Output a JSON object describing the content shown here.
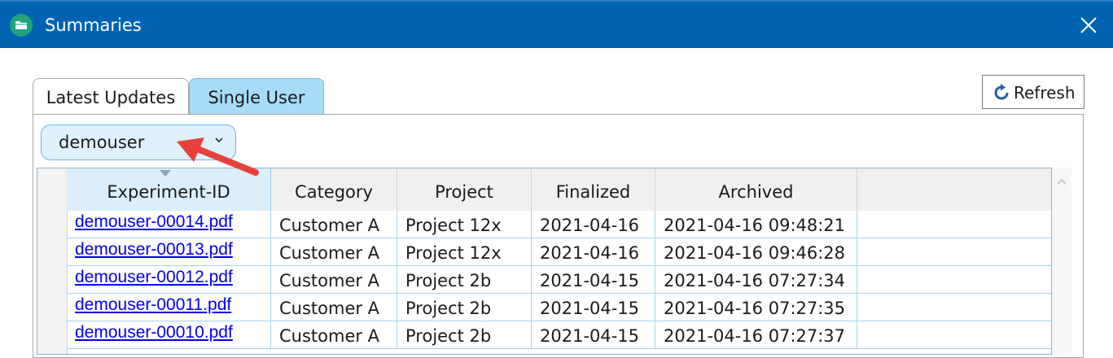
{
  "window": {
    "title": "Summaries",
    "app_icon": "folder-icon",
    "close_icon": "close-icon",
    "accent_color": "#0063b1"
  },
  "tabs": [
    {
      "label": "Latest Updates",
      "selected": false
    },
    {
      "label": "Single User",
      "selected": true
    }
  ],
  "toolbar": {
    "refresh_label": "Refresh",
    "refresh_icon": "refresh-icon"
  },
  "user_select": {
    "value": "demouser",
    "icon": "chevron-down-icon"
  },
  "annotation": {
    "icon": "red-arrow-icon",
    "color": "#e8413c"
  },
  "table": {
    "columns": [
      "Experiment-ID",
      "Category",
      "Project",
      "Finalized",
      "Archived"
    ],
    "sorted_column": "Experiment-ID",
    "rows": [
      [
        "demouser-00014.pdf",
        "Customer A",
        "Project 12x",
        "2021-04-16",
        "2021-04-16 09:48:21"
      ],
      [
        "demouser-00013.pdf",
        "Customer A",
        "Project 12x",
        "2021-04-16",
        "2021-04-16 09:46:28"
      ],
      [
        "demouser-00012.pdf",
        "Customer A",
        "Project 2b",
        "2021-04-15",
        "2021-04-16 07:27:34"
      ],
      [
        "demouser-00011.pdf",
        "Customer A",
        "Project 2b",
        "2021-04-15",
        "2021-04-16 07:27:35"
      ],
      [
        "demouser-00010.pdf",
        "Customer A",
        "Project 2b",
        "2021-04-15",
        "2021-04-16 07:27:37"
      ]
    ]
  }
}
